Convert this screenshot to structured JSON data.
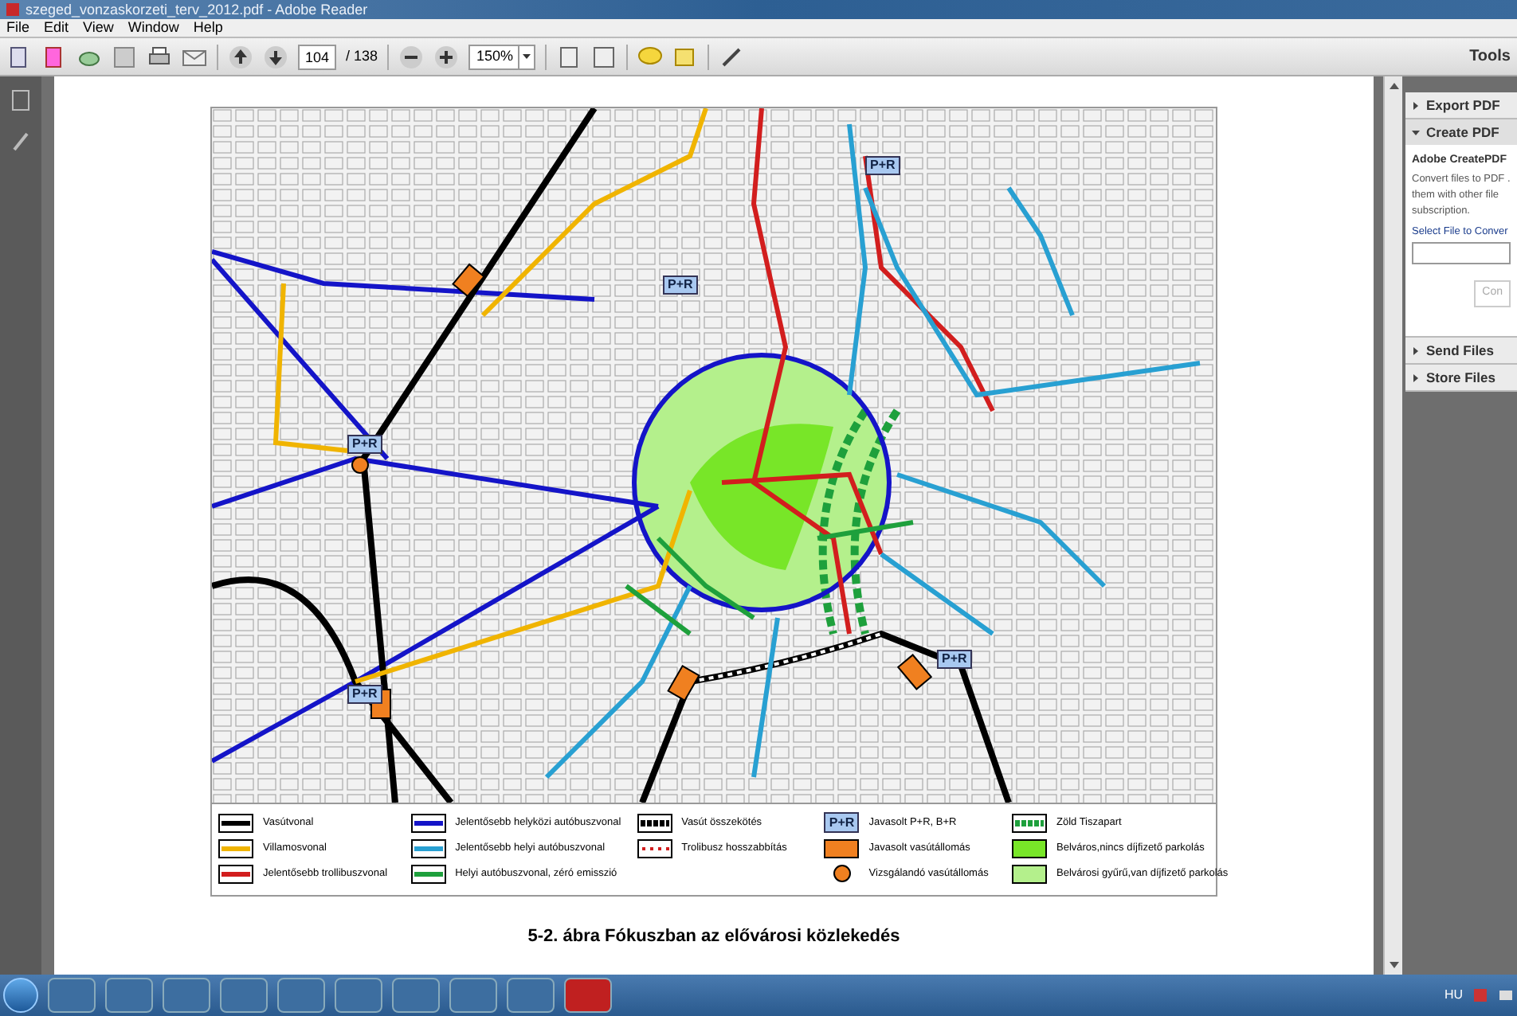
{
  "window": {
    "title": "szeged_vonzaskorzeti_terv_2012.pdf - Adobe Reader"
  },
  "menu": [
    "File",
    "Edit",
    "View",
    "Window",
    "Help"
  ],
  "toolbar": {
    "page": "104",
    "page_total": "/ 138",
    "zoom": "150%",
    "tools": "Tools"
  },
  "map": {
    "labels": [
      "P+R",
      "P+R",
      "P+R",
      "P+R",
      "P+R"
    ]
  },
  "legend": [
    [
      {
        "kind": "line",
        "color": "#000000",
        "label": "Vasútvonal"
      },
      {
        "kind": "line",
        "color": "#f0b400",
        "label": "Villamosvonal"
      },
      {
        "kind": "line",
        "color": "#d21e1e",
        "label": "Jelentősebb trollibuszvonal"
      }
    ],
    [
      {
        "kind": "line",
        "color": "#1414c8",
        "label": "Jelentősebb helyközi autóbuszvonal"
      },
      {
        "kind": "line",
        "color": "#28a0d2",
        "label": "Jelentősebb helyi autóbuszvonal"
      },
      {
        "kind": "line",
        "color": "#1ea03c",
        "label": "Helyi autóbuszvonal, zéró emisszió"
      }
    ],
    [
      {
        "kind": "dashed",
        "color": "#000000",
        "label": "Vasút összekötés"
      },
      {
        "kind": "dotted",
        "color": "#d21e1e",
        "label": "Trolibusz hosszabbítás"
      }
    ],
    [
      {
        "kind": "badge",
        "color": "#a8c8f0",
        "text": "P+R",
        "label": "Javasolt P+R, B+R"
      },
      {
        "kind": "square",
        "color": "#f08020",
        "label": "Javasolt vasútállomás"
      },
      {
        "kind": "circle",
        "color": "#f08020",
        "label": "Vizsgálandó vasútállomás"
      }
    ],
    [
      {
        "kind": "dashed",
        "color": "#1ea03c",
        "label": "Zöld Tiszapart"
      },
      {
        "kind": "square",
        "color": "#78e628",
        "label": "Belváros,nincs díjfizető parkolás"
      },
      {
        "kind": "square",
        "color": "#b4f08c",
        "label": "Belvárosi gyűrű,van díjfizető parkolás"
      }
    ]
  ],
  "caption": "5-2. ábra Fókuszban az elővárosi közlekedés",
  "side_panel": {
    "sections": [
      {
        "label": "Export PDF",
        "expanded": false
      },
      {
        "label": "Create PDF",
        "expanded": true,
        "heading": "Adobe CreatePDF",
        "text_lines": [
          "Convert files to PDF .",
          "them with other file",
          "subscription."
        ],
        "link": "Select File to Conver",
        "button": "Con"
      },
      {
        "label": "Send Files",
        "expanded": false
      },
      {
        "label": "Store Files",
        "expanded": false
      }
    ]
  },
  "taskbar": {
    "language": "HU"
  }
}
